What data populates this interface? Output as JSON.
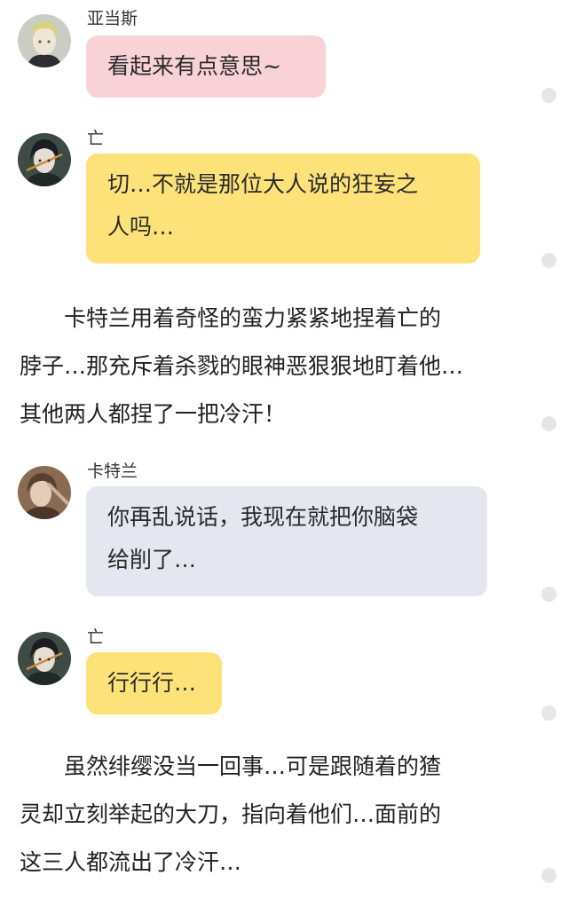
{
  "messages": [
    {
      "name": "亚当斯",
      "lines": [
        "看起来有点意思~"
      ],
      "color": "#f9d2d8",
      "avatar": "blonde-character-avatar"
    },
    {
      "name": "亡",
      "lines": [
        "切…不就是那位大人说的狂妄之",
        "人吗…"
      ],
      "color": "#fde27a",
      "avatar": "dark-hair-character-avatar"
    },
    {
      "name": "卡特兰",
      "lines": [
        "你再乱说话，我现在就把你脑袋",
        "给削了…"
      ],
      "color": "#e4e7ef",
      "avatar": "brown-character-avatar"
    },
    {
      "name": "亡",
      "lines": [
        "行行行…"
      ],
      "color": "#fde27a",
      "avatar": "dark-hair-character-avatar"
    }
  ],
  "narrations": [
    {
      "lines": [
        "　　卡特兰用着奇怪的蛮力紧紧地捏着亡的",
        "脖子…那充斥着杀戮的眼神恶狠狠地盯着他…",
        "其他两人都捏了一把冷汗！"
      ]
    },
    {
      "lines": [
        "　　虽然绯缨没当一回事…可是跟随着的猹",
        "灵却立刻举起的大刀，指向着他们…面前的",
        "这三人都流出了冷汗…"
      ]
    }
  ]
}
